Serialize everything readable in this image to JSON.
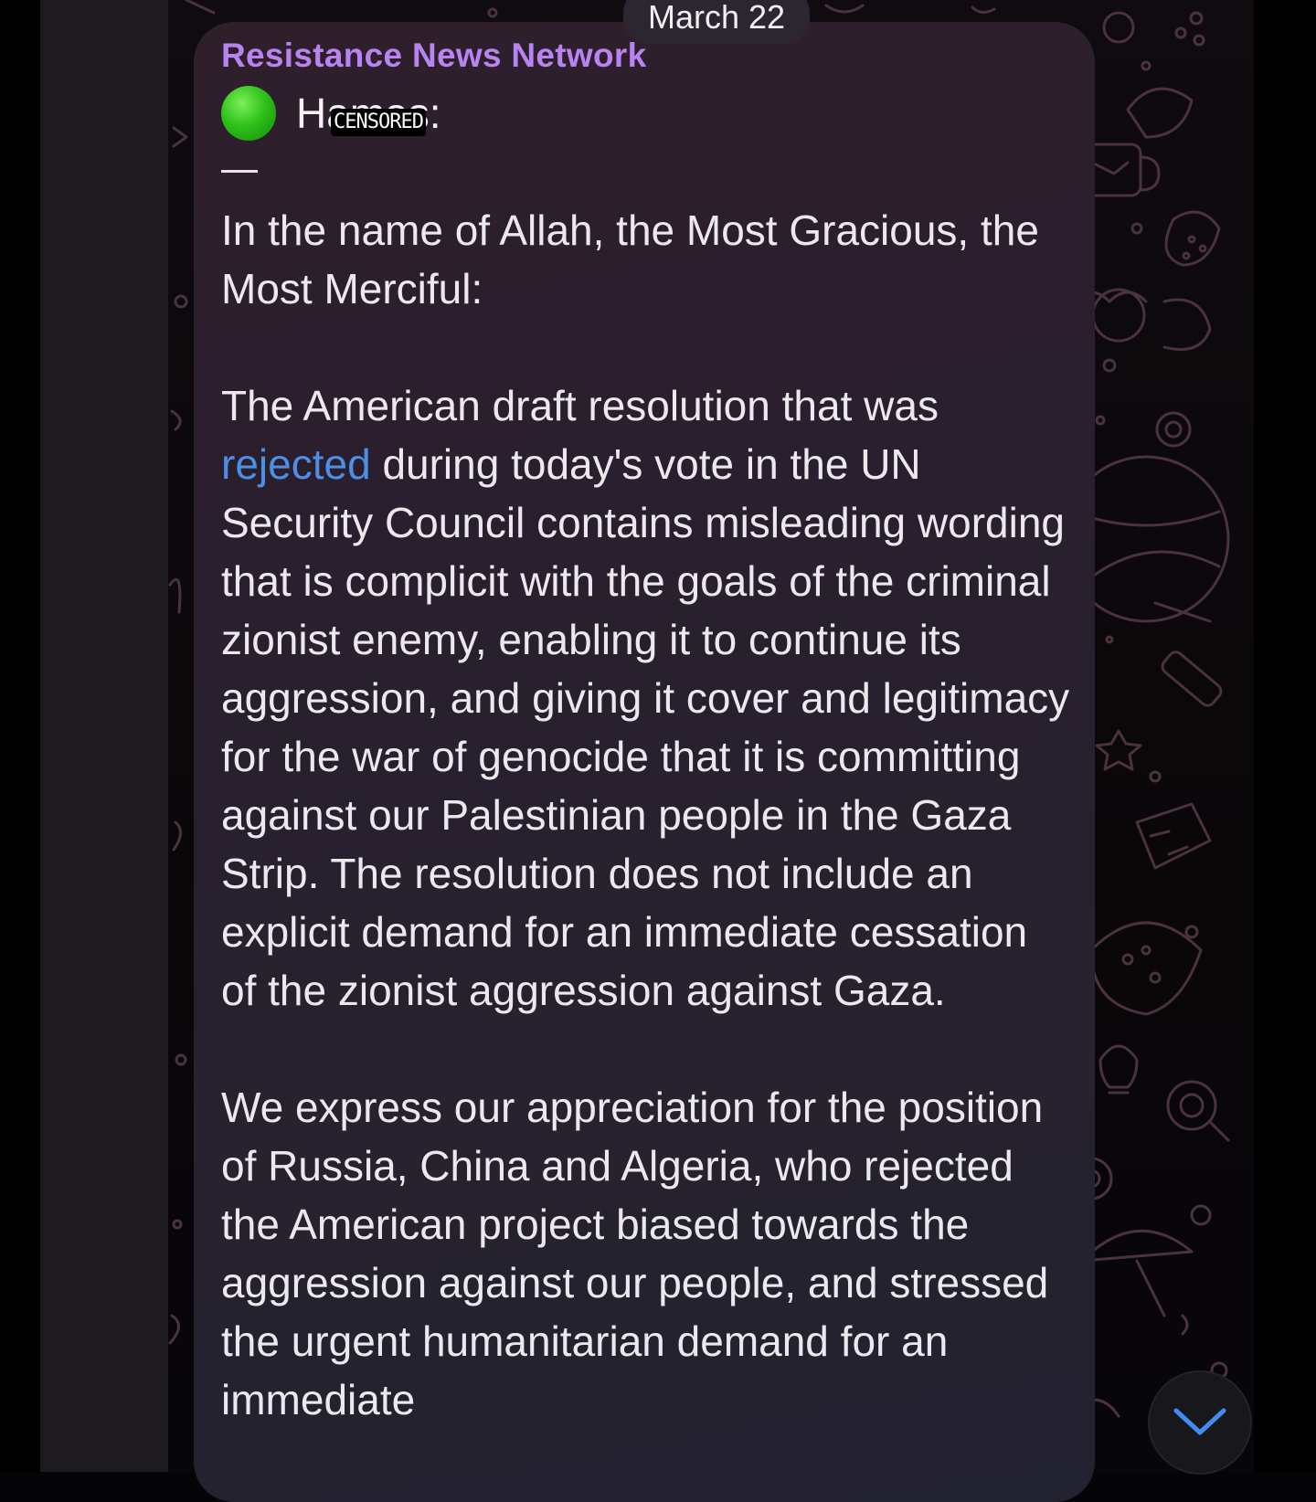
{
  "date_label": "March 22",
  "message": {
    "sender": "Resistance News Network",
    "title_prefix": "H",
    "title_hidden": "amas",
    "title_suffix": ":",
    "censor_label": "CENSORED",
    "dash": "—",
    "paragraph1": "In the name of Allah, the Most Gracious, the Most Merciful:",
    "paragraph2_prefix": "The American draft resolution that was",
    "paragraph2_link": "rejected",
    "paragraph2_rest": "during today's vote in the UN Security Council contains misleading wording that is complicit with the goals of the criminal zionist enemy, enabling it to continue its aggression, and giving it cover and legitimacy for the war of genocide that it is committing against our Palestinian people in the Gaza Strip. The resolution does not include an explicit demand for an immediate cessation of the zionist aggression against Gaza.",
    "paragraph3": "We express our appreciation for the position of Russia, China and Algeria, who rejected the American project biased towards the aggression against our people, and stressed the urgent humanitarian demand for an immediate"
  },
  "colors": {
    "sender": "#b884f2",
    "link": "#4d8fe6",
    "text": "#ece9ee",
    "scroll_chevron": "#3f8ef0"
  },
  "icons": {
    "status": "green-circle-icon",
    "scroll": "chevron-down-icon"
  }
}
